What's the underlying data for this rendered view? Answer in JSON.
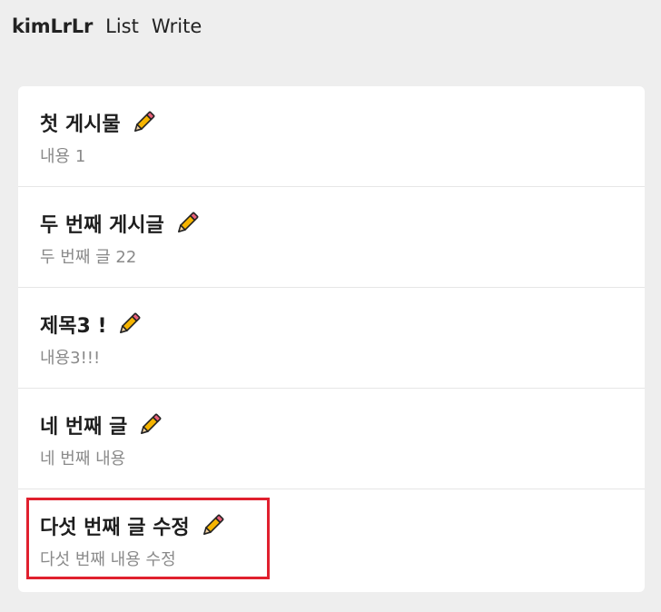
{
  "nav": {
    "brand": "kimLrLr",
    "links": [
      "List",
      "Write"
    ]
  },
  "posts": [
    {
      "title": "첫 게시물",
      "content": "내용 1"
    },
    {
      "title": "두 번째 게시글",
      "content": "두 번째 글 22"
    },
    {
      "title": "제목3 !",
      "content": "내용3!!!"
    },
    {
      "title": "네 번째 글",
      "content": "네 번째 내용"
    },
    {
      "title": "다섯 번째 글 수정",
      "content": "다섯 번째 내용 수정"
    }
  ],
  "icons": {
    "edit": "pencil-icon"
  },
  "colors": {
    "page_background": "#eeeeee",
    "card_background": "#ffffff",
    "highlight_border": "#e0202e",
    "pencil_body": "#f5b400",
    "pencil_eraser": "#e8607a"
  }
}
